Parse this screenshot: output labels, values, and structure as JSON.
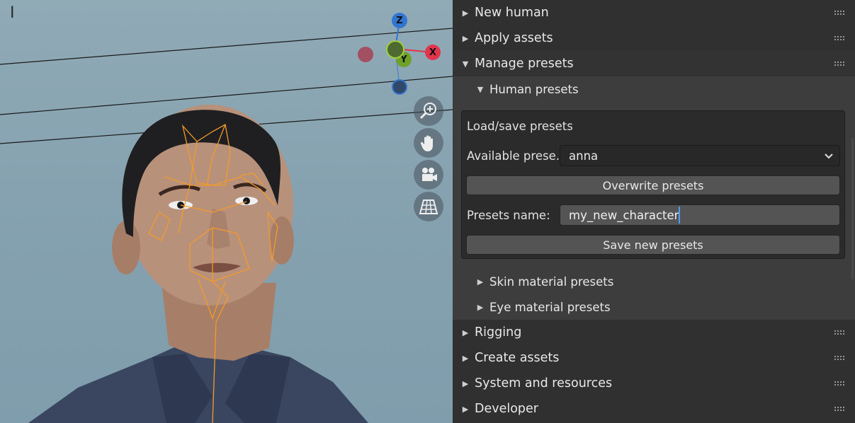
{
  "viewport": {
    "gizmo": {
      "z_label": "Z",
      "x_label": "X",
      "y_label": "Y"
    },
    "colors": {
      "x_axis": "#e2344c",
      "y_axis": "#6fa12a",
      "z_axis": "#3275d0",
      "rig": "#f39a2a"
    },
    "nav_icons": [
      "zoom-icon",
      "pan-hand-icon",
      "camera-icon",
      "grid-perspective-icon"
    ]
  },
  "panel": {
    "sections": [
      {
        "label": "New human",
        "open": false
      },
      {
        "label": "Apply assets",
        "open": false
      },
      {
        "label": "Manage presets",
        "open": true
      },
      {
        "label": "Rigging",
        "open": false
      },
      {
        "label": "Create assets",
        "open": false
      },
      {
        "label": "System and resources",
        "open": false
      },
      {
        "label": "Developer",
        "open": false
      }
    ],
    "subsections": [
      {
        "label": "Human presets",
        "open": true
      },
      {
        "label": "Skin material presets",
        "open": false
      },
      {
        "label": "Eye material presets",
        "open": false
      }
    ],
    "human_presets": {
      "heading": "Load/save presets",
      "available_label": "Available prese...",
      "available_value": "anna",
      "overwrite_button": "Overwrite presets",
      "name_label": "Presets name:",
      "name_value": "my_new_character",
      "save_button": "Save new presets"
    }
  }
}
